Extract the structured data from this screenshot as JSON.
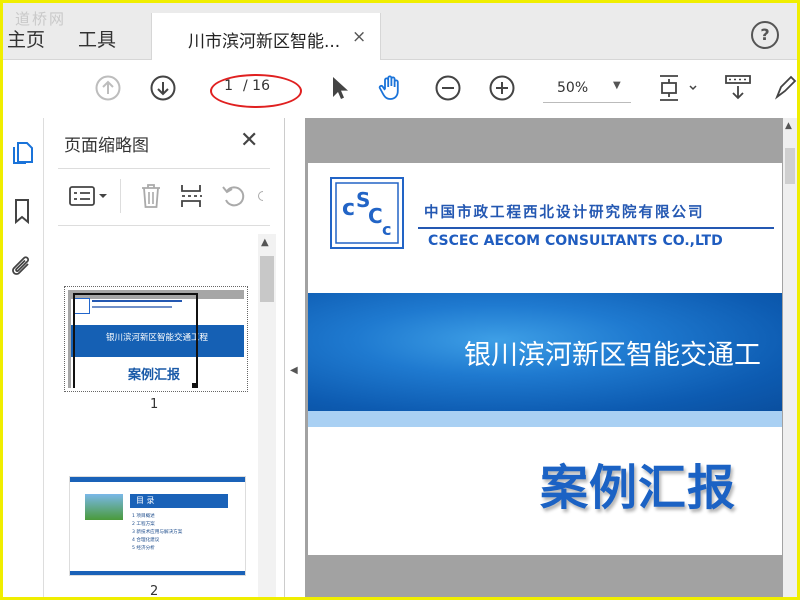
{
  "tabs": {
    "home": "主页",
    "tools": "工具",
    "document": "川市滨河新区智能...",
    "close_glyph": "×",
    "help": "?"
  },
  "watermark": "道桥网",
  "toolbar": {
    "page_current": "1",
    "page_total": "/ 16",
    "zoom": "50%",
    "annotation_color": "#e02020"
  },
  "thumbnails_panel": {
    "title": "页面缩略图",
    "close_glyph": "✕",
    "pages": [
      {
        "number": "1",
        "banner_text": "银川滨河新区智能交通工程",
        "case_text": "案例汇报"
      },
      {
        "number": "2",
        "toc_title": "目 录",
        "toc_items": [
          "1  项目概述",
          "2  工程方案",
          "3  新技术应用与解决方案",
          "4  合理化建议",
          "5  经济分析"
        ]
      }
    ]
  },
  "document": {
    "company_cn": "中国市政工程西北设计研究院有限公司",
    "company_en": "CSCEC   AECOM   CONSULTANTS CO.,LTD",
    "banner_title": "银川滨河新区智能交通工",
    "case_title": "案例汇报",
    "brand_color": "#1f5cbf"
  },
  "icons": {
    "rail": [
      "pages-icon",
      "bookmark-icon",
      "attachment-icon"
    ],
    "toolbar": [
      "prev-page-icon",
      "next-page-icon",
      "select-arrow-icon",
      "hand-icon",
      "zoom-out-icon",
      "zoom-in-icon",
      "fit-page-icon",
      "scroll-mode-icon",
      "sign-icon"
    ]
  }
}
